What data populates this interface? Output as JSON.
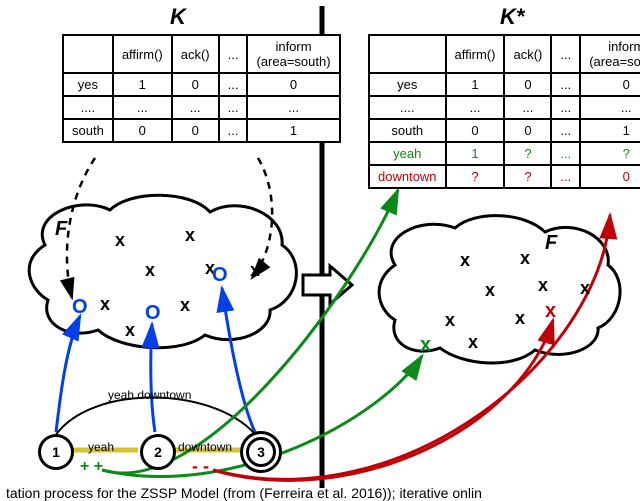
{
  "titles": {
    "K": "K",
    "Kstar": "K*"
  },
  "F_left_label": "F",
  "F_right_label": "F",
  "tableK": {
    "header_blank": "",
    "columns": [
      "affirm()",
      "ack()",
      "...",
      "inform\n(area=south)"
    ],
    "rows": [
      {
        "rowhead": "yes",
        "cells": [
          "1",
          "0",
          "...",
          "0"
        ]
      },
      {
        "rowhead": "....",
        "cells": [
          "...",
          "...",
          "...",
          "..."
        ]
      },
      {
        "rowhead": "south",
        "cells": [
          "0",
          "0",
          "...",
          "1"
        ]
      }
    ]
  },
  "tableKstar": {
    "header_blank": "",
    "columns": [
      "affirm()",
      "ack()",
      "...",
      "inform\n(area=south)"
    ],
    "rows": [
      {
        "rowhead": "yes",
        "cells": [
          "1",
          "0",
          "...",
          "0"
        ]
      },
      {
        "rowhead": "....",
        "cells": [
          "...",
          "...",
          "...",
          "..."
        ]
      },
      {
        "rowhead": "south",
        "cells": [
          "0",
          "0",
          "...",
          "1"
        ]
      }
    ],
    "extra_rows": [
      {
        "rowhead": "yeah",
        "cells": [
          "1",
          "?",
          "...",
          "?"
        ],
        "cls": "row-green"
      },
      {
        "rowhead": "downtown",
        "cells": [
          "?",
          "?",
          "...",
          "0"
        ],
        "cls": "row-red"
      }
    ]
  },
  "nodes": {
    "n1": "1",
    "n2": "2",
    "n3": "3"
  },
  "edges": {
    "e12": "yeah",
    "e23": "downtown",
    "e13": "yeah downtown",
    "plus": "+ +",
    "minus": "- -"
  },
  "caption_text": "tation process for the ZSSP Model (from (Ferreira et al. 2016)); iterative onlin"
}
